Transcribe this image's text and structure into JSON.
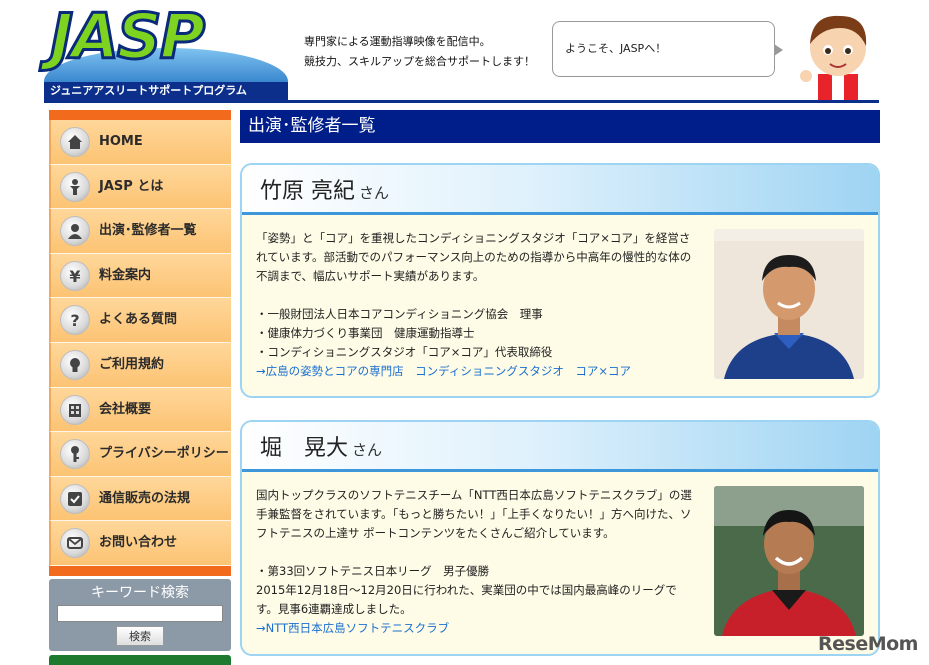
{
  "header": {
    "logo_text": "JASP",
    "logo_subtitle": "ジュニアアスリートサポートプログラム",
    "tagline_line1": "専門家による運動指導映像を配信中。",
    "tagline_line2": "競技力、スキルアップを総合サポートします！",
    "greeting": "ようこそ、JASPへ！"
  },
  "sidebar": {
    "items": [
      {
        "label": "HOME",
        "icon": "home-icon"
      },
      {
        "label": "JASP とは",
        "icon": "person-icon"
      },
      {
        "label": "出演･監修者一覧",
        "icon": "user-icon"
      },
      {
        "label": "料金案内",
        "icon": "yen-icon"
      },
      {
        "label": "よくある質問",
        "icon": "question-icon"
      },
      {
        "label": "ご利用規約",
        "icon": "lightbulb-icon"
      },
      {
        "label": "会社概要",
        "icon": "building-icon"
      },
      {
        "label": "プライバシーポリシー",
        "icon": "key-icon"
      },
      {
        "label": "通信販売の法規",
        "icon": "checkbox-icon"
      },
      {
        "label": "お問い合わせ",
        "icon": "mail-icon"
      }
    ],
    "search": {
      "title": "キーワード検索",
      "input_value": "",
      "button_label": "検索"
    }
  },
  "main": {
    "page_title": "出演･監修者一覧",
    "performers": [
      {
        "name": "竹原 亮紀",
        "suffix": "さん",
        "description": "「姿勢」と「コア」を重視したコンディショニングスタジオ「コア×コア」を経営されています。部活動でのパフォーマンス向上のための指導から中高年の慢性的な体の不調まで、幅広いサポート実績があります。",
        "credentials": [
          "・一般財団法人日本コアコンディショニング協会　理事",
          "・健康体力づくり事業団　健康運動指導士",
          "・コンディショニングスタジオ「コア×コア」代表取締役"
        ],
        "link": "→広島の姿勢とコアの専門店　コンディショニングスタジオ　コア×コア"
      },
      {
        "name": "堀　晃大",
        "suffix": "さん",
        "description": "国内トップクラスのソフトテニスチーム「NTT西日本広島ソフトテニスクラブ」の選手兼監督をされています。「もっと勝ちたい！」「上手くなりたい！」方へ向けた、ソフトテニスの上達サ ポートコンテンツをたくさんご紹介しています。",
        "credentials": [
          "・第33回ソフトテニス日本リーグ　男子優勝",
          "2015年12月18日～12月20日に行われた、実業団の中では国内最高峰のリーグです。見事6連覇達成しました。"
        ],
        "link": "→NTT西日本広島ソフトテニスクラブ"
      }
    ]
  },
  "watermark": "ReseMom",
  "colors": {
    "nav_bg": "#fcc373",
    "nav_accent": "#f26a1b",
    "title_bar": "#001e8a",
    "card_border": "#9dd3f3",
    "link": "#1a6fd0"
  }
}
